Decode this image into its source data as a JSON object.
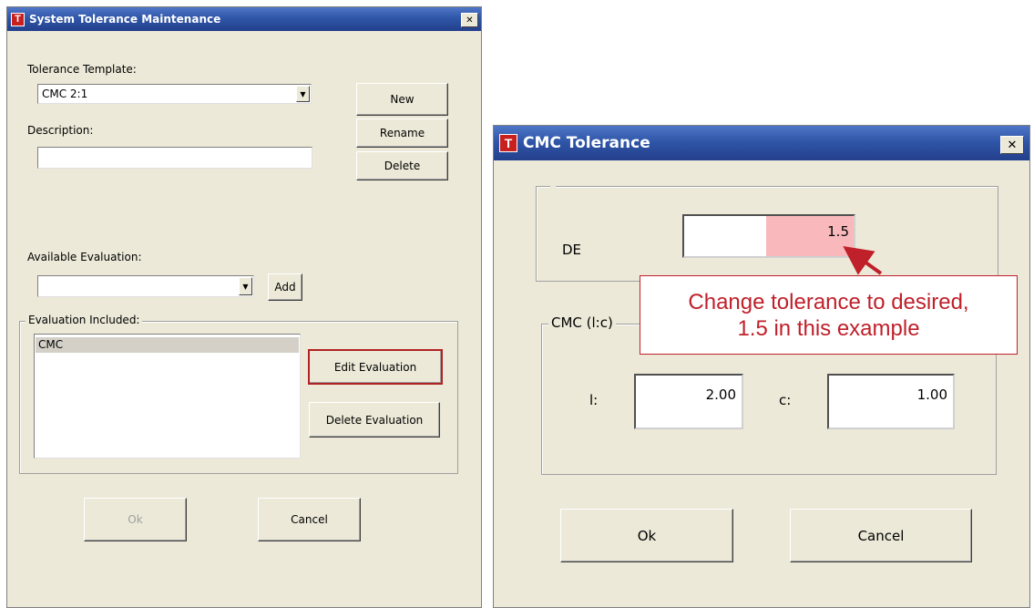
{
  "sys_dialog": {
    "title": "System Tolerance Maintenance",
    "icon_letter": "T",
    "close_glyph": "✕",
    "tolerance_template_label": "Tolerance Template:",
    "tolerance_template_value": "CMC 2:1",
    "description_label": "Description:",
    "description_value": "",
    "new_label": "New",
    "rename_label": "Rename",
    "delete_label": "Delete",
    "available_evaluation_label": "Available Evaluation:",
    "available_evaluation_value": "",
    "add_label": "Add",
    "evaluation_included_label": "Evaluation Included:",
    "evaluations": [
      "CMC"
    ],
    "edit_evaluation_label": "Edit Evaluation",
    "delete_evaluation_label": "Delete Evaluation",
    "ok_label": "Ok",
    "cancel_label": "Cancel"
  },
  "cmc_dialog": {
    "title": "CMC Tolerance",
    "icon_letter": "T",
    "close_glyph": "✕",
    "de_label": "DE",
    "de_value": "1.5",
    "group_label": "CMC (l:c)",
    "l_label": "l:",
    "l_value": "2.00",
    "c_label": "c:",
    "c_value": "1.00",
    "ok_label": "Ok",
    "cancel_label": "Cancel"
  },
  "callout": {
    "line1": "Change tolerance to desired,",
    "line2": "1.5 in this example",
    "border_color": "#c0202a",
    "text_color": "#c0202a"
  },
  "colors": {
    "dialog_bg": "#ece9d8",
    "titlebar": "#2f56a8",
    "highlight_border": "#b22222",
    "de_highlight": "#f9b9bc"
  }
}
